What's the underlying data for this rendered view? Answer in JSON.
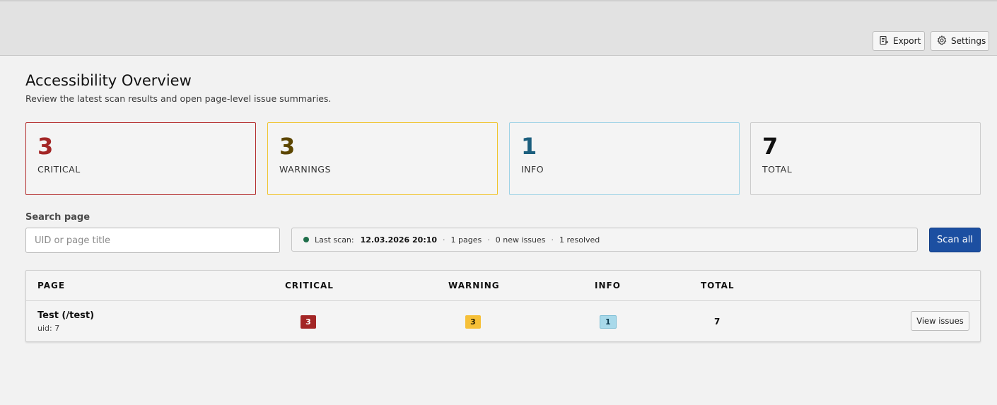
{
  "toolbar": {
    "export_label": "Export",
    "settings_label": "Settings"
  },
  "header": {
    "title": "Accessibility Overview",
    "subtitle": "Review the latest scan results and open page-level issue summaries."
  },
  "stats": [
    {
      "value": "3",
      "label": "CRITICAL",
      "color": "#a32626"
    },
    {
      "value": "3",
      "label": "WARNINGS",
      "color": "#5c4600"
    },
    {
      "value": "1",
      "label": "INFO",
      "color": "#1c5f7e"
    },
    {
      "value": "7",
      "label": "TOTAL",
      "color": "#111111"
    }
  ],
  "search": {
    "label": "Search page",
    "placeholder": "UID or page title",
    "value": ""
  },
  "scan_status": {
    "prefix": "Last scan:",
    "datetime": "12.03.2026 20:10",
    "pages": "1 pages",
    "new_issues": "0 new issues",
    "resolved": "1 resolved",
    "separator": "·"
  },
  "scan_all_label": "Scan all",
  "table": {
    "columns": [
      "PAGE",
      "CRITICAL",
      "WARNING",
      "INFO",
      "TOTAL"
    ],
    "rows": [
      {
        "title": "Test (/test)",
        "uid": "uid: 7",
        "critical": "3",
        "warning": "3",
        "info": "1",
        "total": "7",
        "action": "View issues"
      }
    ]
  },
  "icons": {
    "export": "export-icon",
    "settings": "gear-icon",
    "status": "status-dot-icon"
  },
  "colors": {
    "accent": "#1c4fa1",
    "critical": "#a32626",
    "warning": "#f6c038",
    "info": "#a8d9ea",
    "status_ok": "#1f6e4a"
  }
}
